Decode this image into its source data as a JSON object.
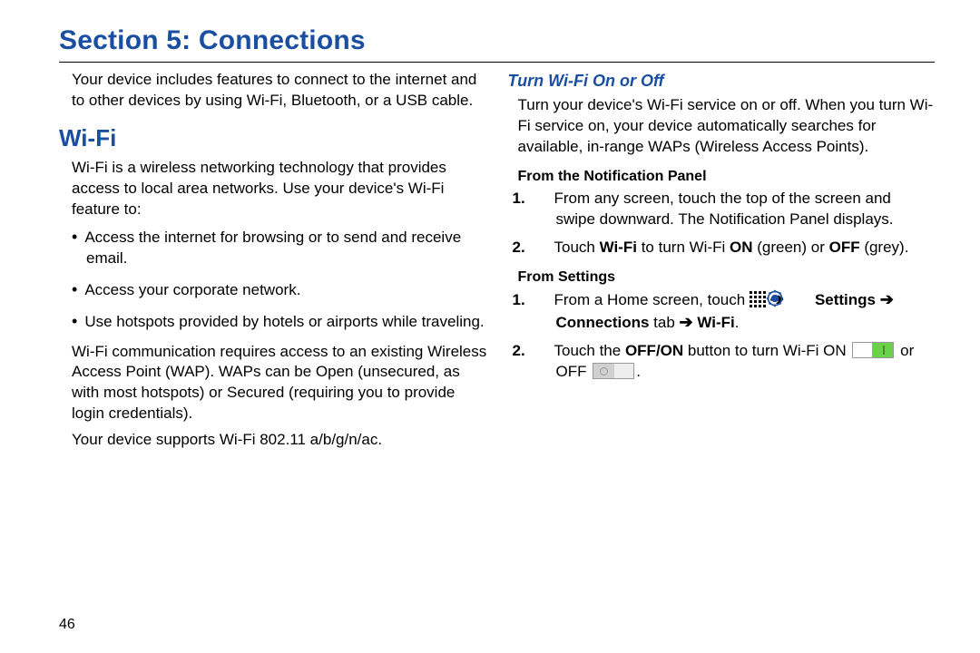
{
  "section_title": "Section 5: Connections",
  "page_number": "46",
  "left": {
    "intro": "Your device includes features to connect to the internet and to other devices by using Wi-Fi, Bluetooth, or a USB cable.",
    "wifi_heading": "Wi-Fi",
    "wifi_intro": "Wi-Fi is a wireless networking technology that provides access to local area networks. Use your device's Wi-Fi feature to:",
    "bullets": [
      "Access the internet for browsing or to send and receive email.",
      "Access your corporate network.",
      "Use hotspots provided by hotels or airports while traveling."
    ],
    "wap_para": "Wi-Fi communication requires access to an existing Wireless Access Point (WAP). WAPs can be Open (unsecured, as with most hotspots) or Secured (requiring you to provide login credentials).",
    "support_para": "Your device supports Wi-Fi 802.11 a/b/g/n/ac."
  },
  "right": {
    "subheading": "Turn Wi-Fi On or Off",
    "intro": "Turn your device's Wi-Fi service on or off. When you turn Wi-Fi service on, your device automatically searches for available, in-range WAPs (Wireless Access Points).",
    "notif_heading": "From the Notification Panel",
    "notif_steps": {
      "s1": "From any screen, touch the top of the screen and swipe downward. The Notification Panel displays.",
      "s2_a": "Touch ",
      "s2_b": "Wi-Fi",
      "s2_c": " to turn Wi-Fi ",
      "s2_d": "ON",
      "s2_e": " (green) or ",
      "s2_f": "OFF",
      "s2_g": " (grey)."
    },
    "settings_heading": "From Settings",
    "settings_steps": {
      "s1_a": "From a Home screen, touch ",
      "s1_b": "Settings",
      "s1_c": "Connections",
      "s1_d": " tab ",
      "s1_e": "Wi-Fi",
      "s2_a": "Touch the ",
      "s2_b": "OFF/ON",
      "s2_c": " button to turn Wi-Fi ON ",
      "s2_d": " or OFF "
    }
  },
  "arrows": {
    "right": "➔"
  }
}
